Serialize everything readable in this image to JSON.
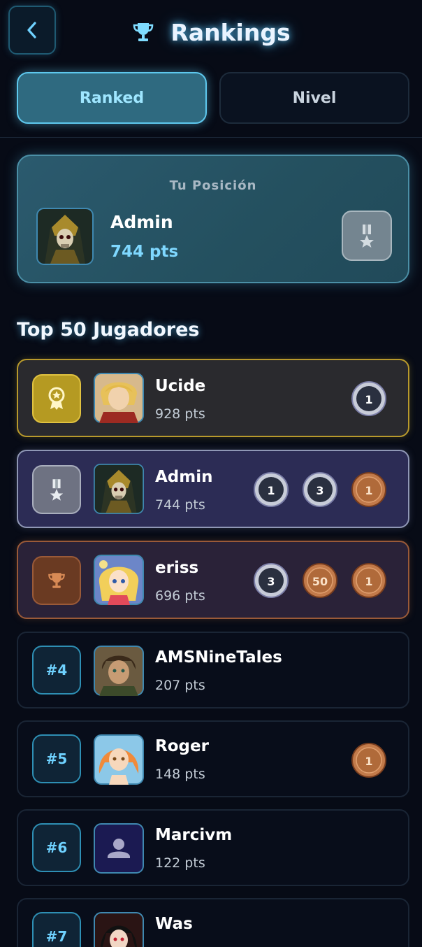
{
  "header": {
    "title": "Rankings",
    "back_icon": "chevron-left-icon",
    "title_icon": "trophy-icon",
    "accent": "#5ec8ee"
  },
  "tabs": [
    {
      "label": "Ranked",
      "active": true
    },
    {
      "label": "Nivel",
      "active": false
    }
  ],
  "my_position": {
    "caption": "Tu Posición",
    "name": "Admin",
    "points": "744 pts",
    "rank_icon": "silver-medal-icon"
  },
  "section_title": "Top 50 Jugadores",
  "players": [
    {
      "rank": "#1",
      "name": "Ucide",
      "points": "928 pts",
      "tier": "gold",
      "rank_icon": "gold-award-icon",
      "badges": [
        {
          "type": "silver",
          "label": "1"
        }
      ]
    },
    {
      "rank": "#2",
      "name": "Admin",
      "points": "744 pts",
      "tier": "silver",
      "rank_icon": "silver-medal-icon",
      "badges": [
        {
          "type": "silver",
          "label": "1"
        },
        {
          "type": "silver",
          "label": "3"
        },
        {
          "type": "bronze",
          "label": "1"
        }
      ]
    },
    {
      "rank": "#3",
      "name": "eriss",
      "points": "696 pts",
      "tier": "bronze",
      "rank_icon": "bronze-trophy-icon",
      "badges": [
        {
          "type": "silver",
          "label": "3"
        },
        {
          "type": "bronze",
          "label": "50"
        },
        {
          "type": "bronze",
          "label": "1"
        }
      ]
    },
    {
      "rank": "#4",
      "name": "AMSNineTales",
      "points": "207 pts",
      "tier": "plain",
      "badges": []
    },
    {
      "rank": "#5",
      "name": "Roger",
      "points": "148 pts",
      "tier": "plain",
      "badges": [
        {
          "type": "bronze",
          "label": "1"
        }
      ]
    },
    {
      "rank": "#6",
      "name": "Marcivm",
      "points": "122 pts",
      "tier": "plain",
      "badges": []
    },
    {
      "rank": "#7",
      "name": "Was",
      "points": "",
      "tier": "plain",
      "badges": []
    }
  ]
}
